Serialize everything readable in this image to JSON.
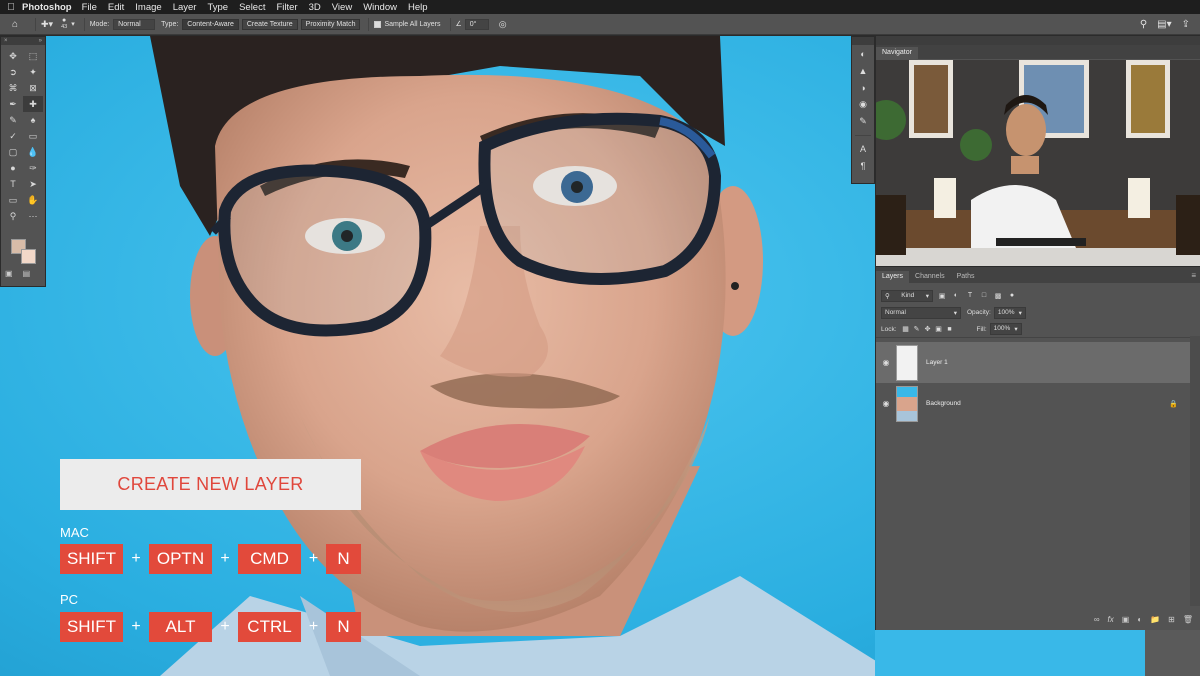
{
  "menubar": {
    "apple_icon": "apple-icon",
    "app_name": "Photoshop",
    "items": [
      "File",
      "Edit",
      "Image",
      "Layer",
      "Type",
      "Select",
      "Filter",
      "3D",
      "View",
      "Window",
      "Help"
    ]
  },
  "options_bar": {
    "brush_size": "43",
    "mode_label": "Mode:",
    "mode_value": "Normal",
    "type_label": "Type:",
    "type_buttons": [
      "Content-Aware",
      "Create Texture",
      "Proximity Match"
    ],
    "sample_all_layers": "Sample All Layers",
    "angle_value": "0°"
  },
  "toolbox": {
    "foreground_color": "#d8bca8",
    "background_color": "#f2d8c8"
  },
  "navigator": {
    "tab": "Navigator"
  },
  "layers_panel": {
    "tabs": [
      "Layers",
      "Channels",
      "Paths"
    ],
    "filter_kind": "Kind",
    "blend_mode": "Normal",
    "opacity_label": "Opacity:",
    "opacity_value": "100%",
    "lock_label": "Lock:",
    "fill_label": "Fill:",
    "fill_value": "100%",
    "layers": [
      {
        "name": "Layer 1",
        "selected": true
      },
      {
        "name": "Background",
        "selected": false,
        "locked": true
      }
    ]
  },
  "overlay": {
    "title": "CREATE NEW LAYER",
    "mac_label": "MAC",
    "mac_keys": [
      "SHIFT",
      "OPTN",
      "CMD",
      "N"
    ],
    "pc_label": "PC",
    "pc_keys": [
      "SHIFT",
      "ALT",
      "CTRL",
      "N"
    ],
    "plus": "+",
    "title_color": "#e0473c",
    "key_color": "#e24a3b"
  }
}
